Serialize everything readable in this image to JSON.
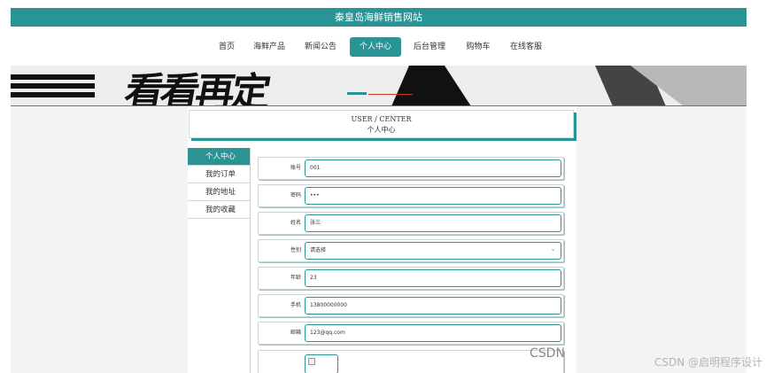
{
  "site": {
    "title": "秦皇岛海鲜销售网站"
  },
  "nav": {
    "items": [
      "首页",
      "海鲜产品",
      "新闻公告",
      "个人中心",
      "后台管理",
      "购物车",
      "在线客服"
    ],
    "active_index": 3
  },
  "banner": {
    "text": "看看再定"
  },
  "header": {
    "en": "USER / CENTER",
    "cn": "个人中心"
  },
  "side_menu": {
    "items": [
      "个人中心",
      "我的订单",
      "我的地址",
      "我的收藏"
    ],
    "active_index": 0
  },
  "form": {
    "fields": [
      {
        "label": "账号",
        "value": "001"
      },
      {
        "label": "密码",
        "value": "•••"
      },
      {
        "label": "姓名",
        "value": "张三"
      },
      {
        "label": "性别",
        "value": "请选择",
        "type": "select"
      },
      {
        "label": "年龄",
        "value": "23"
      },
      {
        "label": "手机",
        "value": "13800000000"
      },
      {
        "label": "邮箱",
        "value": "123@qq.com"
      }
    ]
  },
  "watermark": {
    "text": "CSDN @启明程序设计",
    "partial": "CSDN"
  },
  "colors": {
    "accent": "#2a9494"
  }
}
